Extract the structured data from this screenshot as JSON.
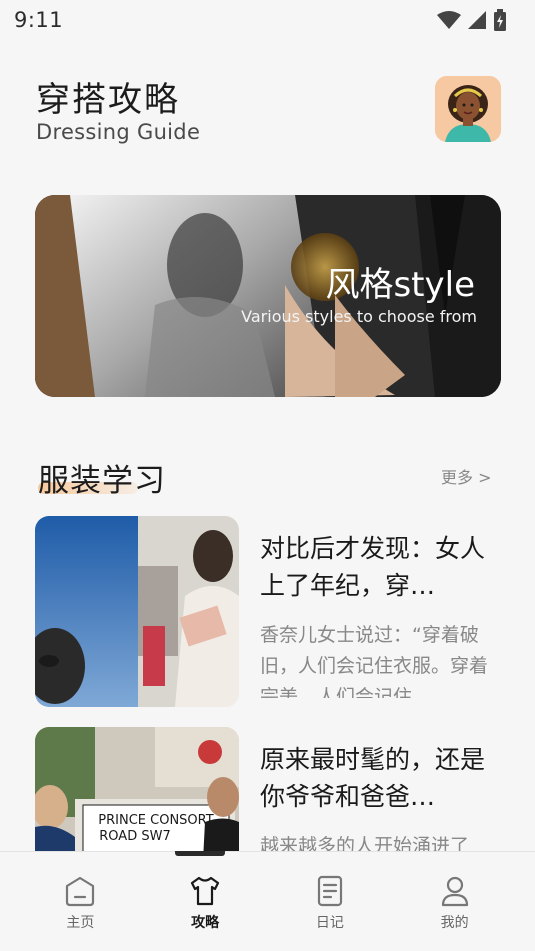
{
  "status_bar": {
    "time": "9:11"
  },
  "header": {
    "title": "穿搭攻略",
    "subtitle": "Dressing Guide"
  },
  "banner": {
    "title": "风格style",
    "subtitle": "Various styles to choose from"
  },
  "section": {
    "title": "服装学习",
    "more_label": "更多 >"
  },
  "articles": [
    {
      "title": "对比后才发现：女人上了年纪，穿…",
      "snippet": "香奈儿女士说过：“穿着破旧，人们会记住衣服。穿着完美，人们会记住"
    },
    {
      "title": "原来最时髦的，还是你爷爷和爸爸…",
      "snippet": "越来越多的人开始涌进了",
      "sign_line1": "PRINCE CONSORT",
      "sign_line2": "ROAD SW7"
    }
  ],
  "bottom_nav": {
    "items": [
      {
        "label": "主页",
        "icon": "home-icon",
        "active": false
      },
      {
        "label": "攻略",
        "icon": "shirt-icon",
        "active": true
      },
      {
        "label": "日记",
        "icon": "notes-icon",
        "active": false
      },
      {
        "label": "我的",
        "icon": "user-icon",
        "active": false
      }
    ]
  },
  "colors": {
    "background": "#f6f6f6",
    "accent_underline": "#f7c99d",
    "muted_text": "#888888"
  }
}
